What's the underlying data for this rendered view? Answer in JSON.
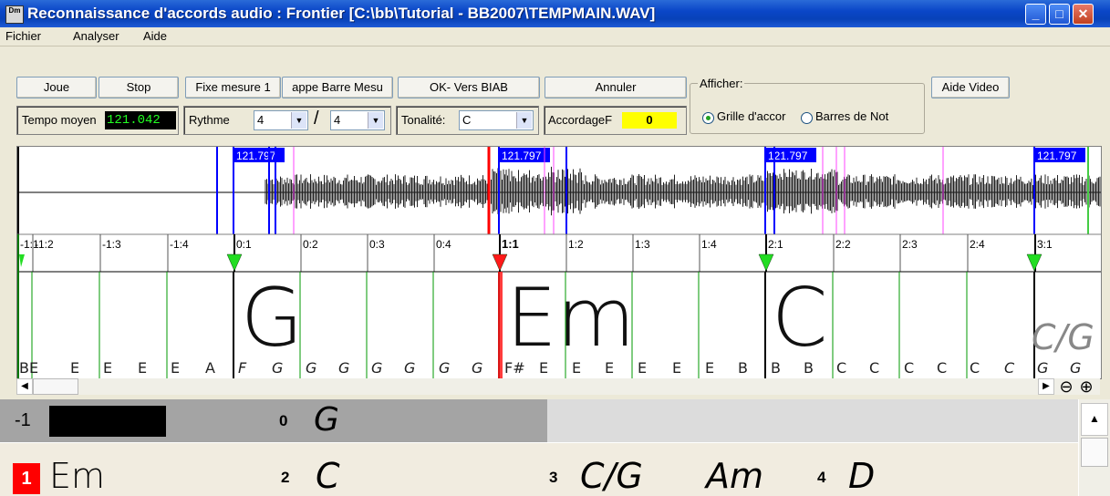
{
  "window": {
    "title": "Reconnaissance d'accords audio : Frontier [C:\\bb\\Tutorial - BB2007\\TEMPMAIN.WAV]",
    "icon_text": "Dm"
  },
  "menu": [
    "Fichier",
    "Analyser",
    "Aide"
  ],
  "toolbar": {
    "joue": "Joue",
    "stop": "Stop",
    "fixe_mesure": "Fixe mesure 1",
    "frappe_barre": "appe Barre Mesu",
    "ok_biab": "OK- Vers BIAB",
    "annuler": "Annuler",
    "aide_video": "Aide Video",
    "tempo_label": "Tempo moyen",
    "tempo_value": "121.042",
    "rythme_label": "Rythme",
    "rythme_num": "4",
    "rythme_den": "4",
    "slash": "/",
    "tonalite_label": "Tonalité:",
    "tonalite_value": "C",
    "accordage_label": "AccordageF",
    "accordage_value": "0",
    "afficher_label": "Afficher:",
    "radio_grille": "Grille d'accor",
    "radio_barres": "Barres de Not"
  },
  "waveform": {
    "tempo_tags": [
      "121.797",
      "121.797",
      "121.797",
      "121.797"
    ]
  },
  "ruler": {
    "labels": [
      "-1:1",
      "-1:2",
      "-1:3",
      "-1:4",
      "0:1",
      "0:2",
      "0:3",
      "0:4",
      "1:1",
      "1:2",
      "1:3",
      "1:4",
      "2:1",
      "2:2",
      "2:3",
      "2:4",
      "3:1"
    ]
  },
  "chords": {
    "big": [
      "G",
      "Em",
      "C",
      "C/G"
    ],
    "notes": [
      "BE",
      "E",
      "E",
      "E",
      "E",
      "A",
      "F",
      "G",
      "G",
      "G",
      "G",
      "G",
      "G",
      "G",
      "F#",
      "E",
      "E",
      "E",
      "E",
      "E",
      "E",
      "B",
      "B",
      "B",
      "C",
      "C",
      "C",
      "C",
      "C",
      "C",
      "G",
      "G"
    ]
  },
  "lower": {
    "row1": {
      "bar_neg": "-1",
      "bar0": "0",
      "chord0": "G"
    },
    "row2": {
      "bar1": "1",
      "chord1": "Em",
      "bar2": "2",
      "chord2": "C",
      "bar3": "3",
      "chord3a": "C/G",
      "chord3b": "Am",
      "bar4": "4",
      "chord4": "D"
    }
  },
  "colors": {
    "title_blue": "#0a46c8",
    "tempo_bg": "#000000",
    "tempo_fg": "#22ff22",
    "accordage_bg": "#ffff00",
    "marker_blue": "#0000ff",
    "marker_red": "#ff0000",
    "marker_magenta": "#ff44ff",
    "beat_green": "#009900",
    "current_bar_red": "#ff1a1a"
  }
}
